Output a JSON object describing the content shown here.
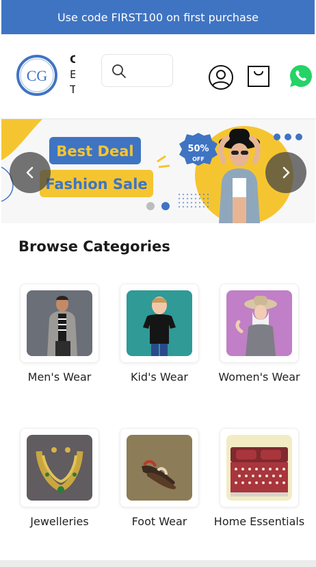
{
  "promo": {
    "text": "Use code FIRST100 on first purchase"
  },
  "header": {
    "logo_text": "CG",
    "brand_clipped_lines": [
      "C",
      "E",
      "T"
    ]
  },
  "banner": {
    "headline_1": "Best Deal",
    "headline_2": "Fashion Sale",
    "badge_percent": "50%",
    "badge_off": "OFF",
    "active_slide": 2,
    "slide_count": 2
  },
  "section": {
    "title": "Browse Categories"
  },
  "categories": [
    {
      "label": "Men's Wear"
    },
    {
      "label": "Kid's Wear"
    },
    {
      "label": "Women's Wear"
    },
    {
      "label": "Jewelleries"
    },
    {
      "label": "Foot Wear"
    },
    {
      "label": "Home Essentials"
    }
  ],
  "colors": {
    "brand_blue": "#3f74c3",
    "banner_yellow": "#f5c531",
    "whatsapp_green": "#25d366"
  }
}
